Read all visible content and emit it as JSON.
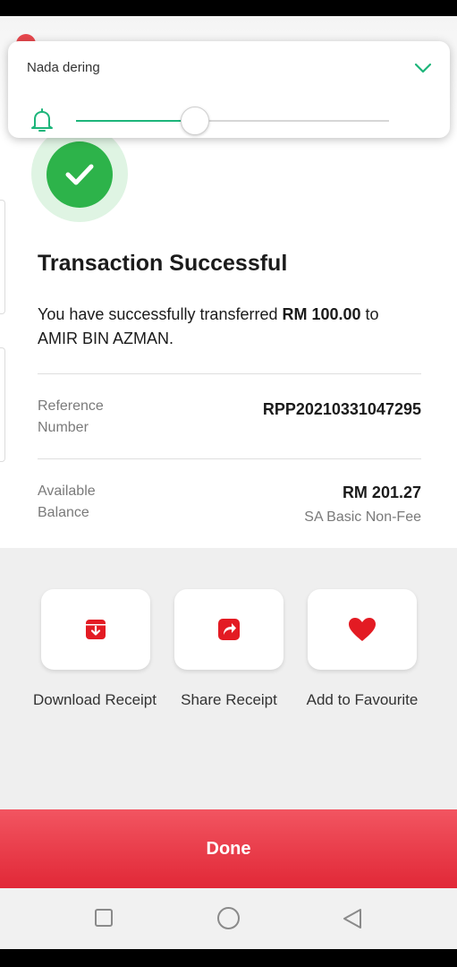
{
  "volume": {
    "label": "Nada dering",
    "level": 0.38
  },
  "transaction": {
    "title": "Transaction Successful",
    "message_prefix": "You have successfully transferred ",
    "amount": "RM 100.00",
    "message_mid": " to",
    "recipient": "AMIR BIN AZMAN."
  },
  "details": {
    "reference_label": "Reference Number",
    "reference_value": "RPP20210331047295",
    "balance_label": "Available Balance",
    "balance_value": "RM 201.27",
    "balance_account": "SA Basic Non-Fee"
  },
  "actions": [
    {
      "label": "Download Receipt",
      "icon": "download-receipt-icon"
    },
    {
      "label": "Share Receipt",
      "icon": "share-icon"
    },
    {
      "label": "Add to Favourite",
      "icon": "heart-icon"
    }
  ],
  "done_label": "Done",
  "colors": {
    "accent": "#e31b23",
    "success": "#2db34a",
    "slider": "#1db57a"
  }
}
